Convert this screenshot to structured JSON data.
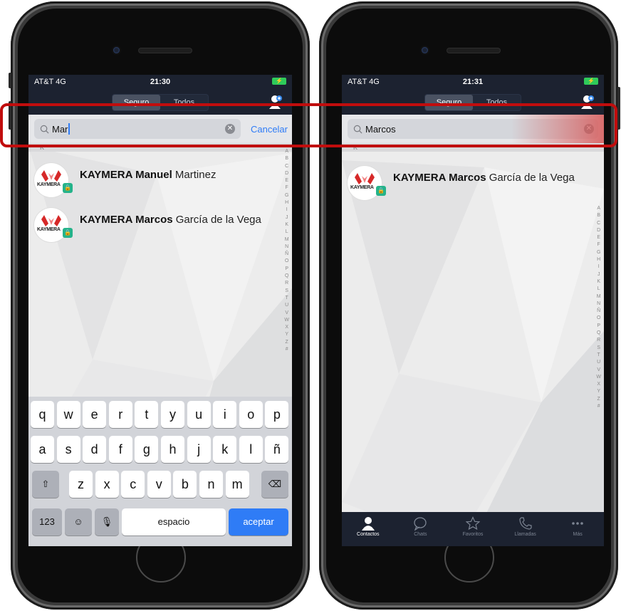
{
  "left_phone": {
    "status": {
      "carrier": "AT&T 4G",
      "time": "21:30"
    },
    "segments": [
      "Seguro",
      "Todos"
    ],
    "search": {
      "value": "Mar",
      "cancel": "Cancelar"
    },
    "section": "K",
    "contacts": [
      {
        "bold": "KAYMERA Manuel",
        "rest": "Martinez"
      },
      {
        "bold": "KAYMERA Marcos",
        "rest": "García de la Vega"
      }
    ],
    "alphabet": [
      "A",
      "B",
      "C",
      "D",
      "E",
      "F",
      "G",
      "H",
      "I",
      "J",
      "K",
      "L",
      "M",
      "N",
      "Ñ",
      "O",
      "P",
      "Q",
      "R",
      "S",
      "T",
      "U",
      "V",
      "W",
      "X",
      "Y",
      "Z",
      "#"
    ],
    "keyboard": {
      "row1": [
        "q",
        "w",
        "e",
        "r",
        "t",
        "y",
        "u",
        "i",
        "o",
        "p"
      ],
      "row2": [
        "a",
        "s",
        "d",
        "f",
        "g",
        "h",
        "j",
        "k",
        "l",
        "ñ"
      ],
      "row3": [
        "z",
        "x",
        "c",
        "v",
        "b",
        "n",
        "m"
      ],
      "numbers": "123",
      "space": "espacio",
      "accept": "aceptar"
    }
  },
  "right_phone": {
    "status": {
      "carrier": "AT&T 4G",
      "time": "21:31"
    },
    "segments": [
      "Seguro",
      "Todos"
    ],
    "search": {
      "value": "Marcos"
    },
    "section": "K",
    "contacts": [
      {
        "bold": "KAYMERA Marcos",
        "rest": "García de la Vega"
      }
    ],
    "alphabet": [
      "A",
      "B",
      "C",
      "D",
      "E",
      "F",
      "G",
      "H",
      "I",
      "J",
      "K",
      "L",
      "M",
      "N",
      "Ñ",
      "O",
      "P",
      "Q",
      "R",
      "S",
      "T",
      "U",
      "V",
      "W",
      "X",
      "Y",
      "Z",
      "#"
    ],
    "tabs": [
      "Contactos",
      "Chats",
      "Favoritos",
      "Llamadas",
      "Más"
    ]
  },
  "avatar_logo_text": "KAYMERA",
  "colors": {
    "accent": "#2f7cf6",
    "highlight": "#c10d0d",
    "secure_badge": "#25b38a",
    "bar": "#1c2230"
  }
}
